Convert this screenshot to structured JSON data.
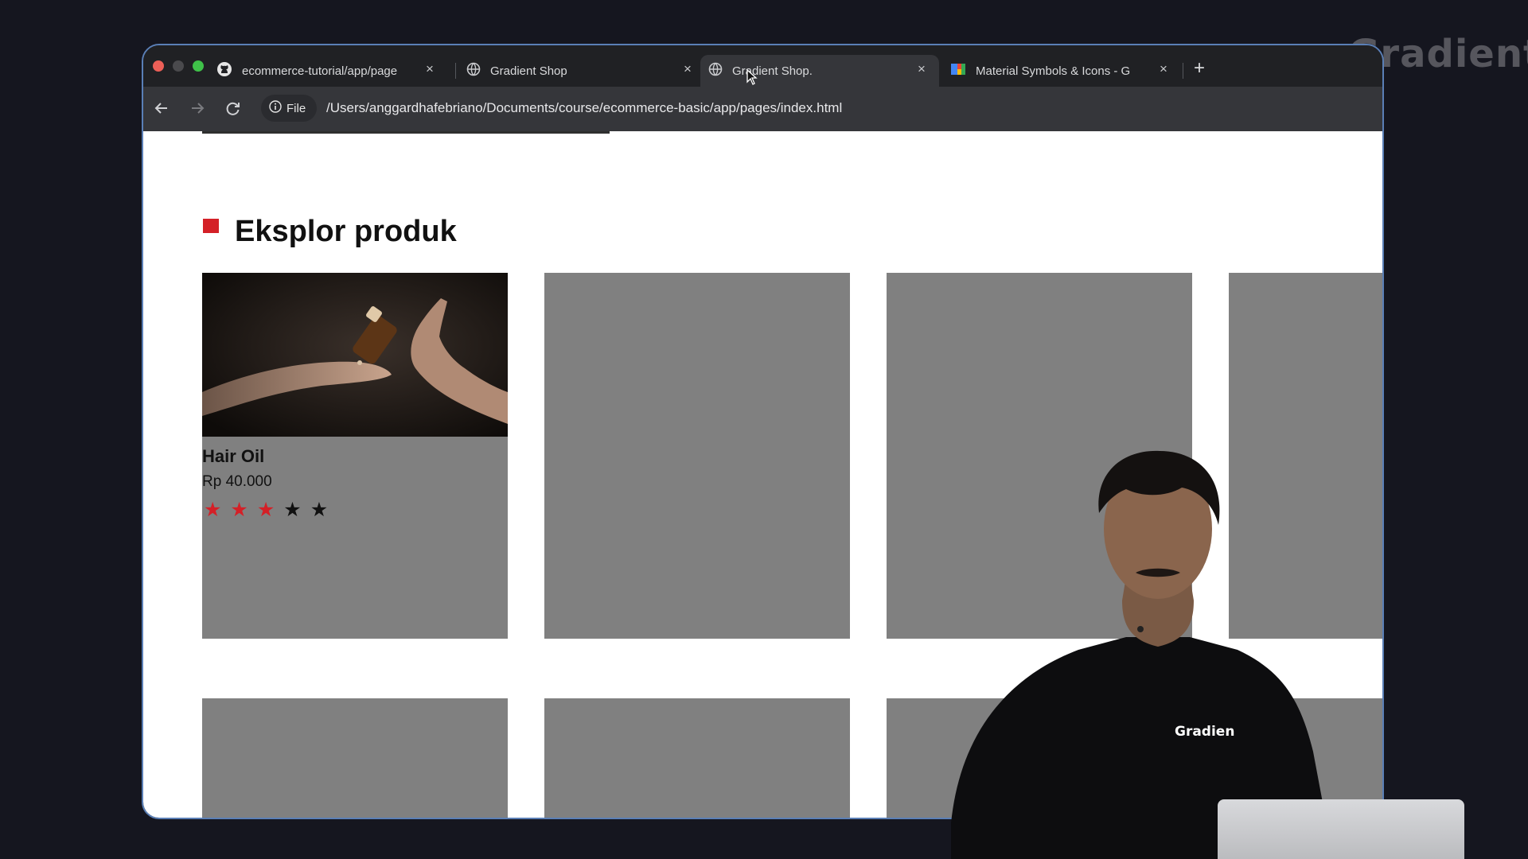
{
  "watermark": {
    "text": "Gradient"
  },
  "browser": {
    "tabs": [
      {
        "label": "ecommerce-tutorial/app/page",
        "icon": "github-icon",
        "active": false
      },
      {
        "label": "Gradient Shop",
        "icon": "globe-icon",
        "active": false
      },
      {
        "label": "Gradient Shop.",
        "icon": "globe-icon",
        "active": true
      },
      {
        "label": "Material Symbols & Icons - G",
        "icon": "material-icon",
        "active": false
      }
    ],
    "close_symbol": "×",
    "new_tab_symbol": "+",
    "address_bar": {
      "security_label": "File",
      "url": "/Users/anggardhafebriano/Documents/course/ecommerce-basic/app/pages/index.html"
    },
    "traffic_light_colors": [
      "#ec5f57",
      "#4a4a4d",
      "#3fc149"
    ]
  },
  "page": {
    "section": {
      "title": "Eksplor produk",
      "accent_color": "#d42027"
    },
    "products": [
      {
        "name": "Hair Oil",
        "price": "Rp 40.000",
        "rating": 3,
        "max_rating": 5
      },
      {
        "name": "",
        "price": ""
      },
      {
        "name": "",
        "price": ""
      },
      {
        "name": "",
        "price": ""
      },
      {
        "name": "",
        "price": ""
      },
      {
        "name": "",
        "price": ""
      },
      {
        "name": "",
        "price": ""
      },
      {
        "name": "",
        "price": ""
      }
    ],
    "placeholder_color": "#808080"
  },
  "presenter": {
    "shirt_text": "Gradien"
  }
}
